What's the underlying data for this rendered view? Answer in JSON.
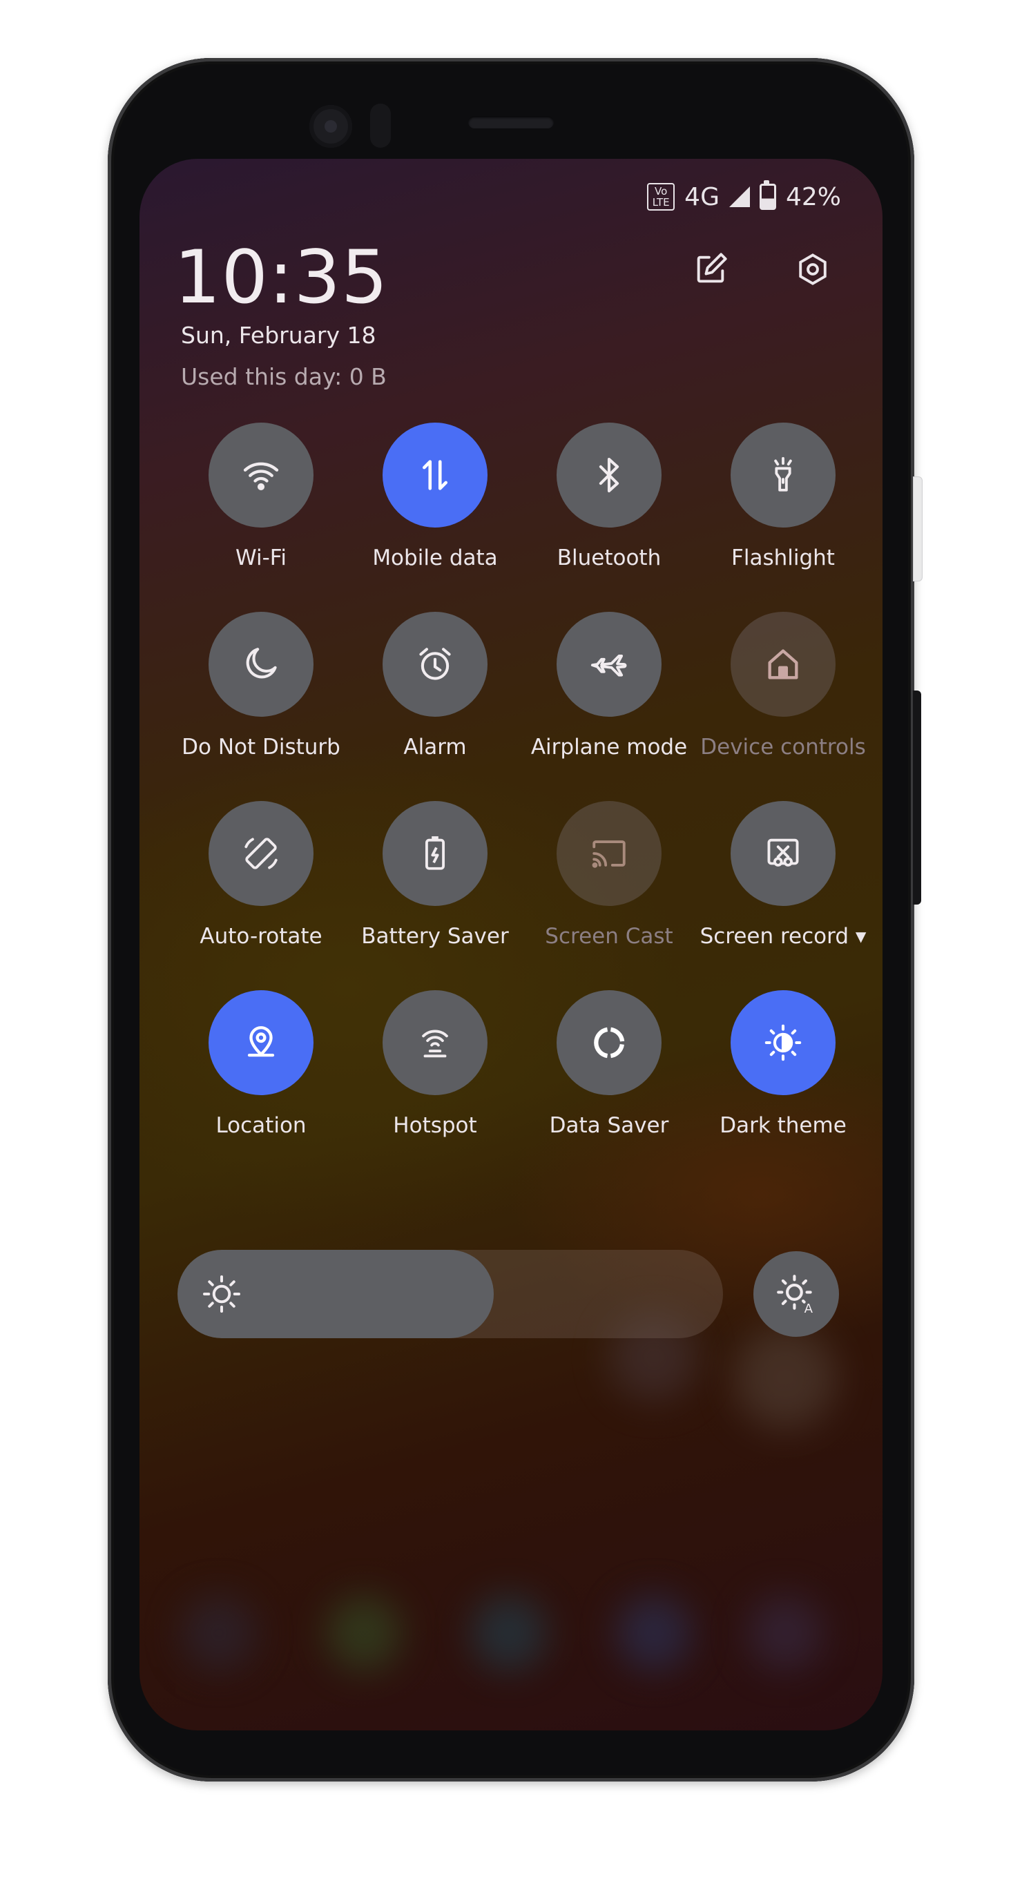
{
  "status_bar": {
    "volte": "Vo LTE",
    "network": "4G",
    "battery": "42%"
  },
  "header": {
    "time": "10:35",
    "date": "Sun, February 18",
    "usage": "Used this day: 0 B"
  },
  "tiles": [
    {
      "label": "Wi-Fi",
      "icon": "wifi-icon",
      "state": "off"
    },
    {
      "label": "Mobile data",
      "icon": "mobile-data-icon",
      "state": "on"
    },
    {
      "label": "Bluetooth",
      "icon": "bluetooth-icon",
      "state": "off"
    },
    {
      "label": "Flashlight",
      "icon": "flashlight-icon",
      "state": "off"
    },
    {
      "label": "Do Not Disturb",
      "icon": "moon-icon",
      "state": "off"
    },
    {
      "label": "Alarm",
      "icon": "alarm-icon",
      "state": "off"
    },
    {
      "label": "Airplane mode",
      "icon": "airplane-icon",
      "state": "off"
    },
    {
      "label": "Device controls",
      "icon": "home-icon",
      "state": "unavailable"
    },
    {
      "label": "Auto-rotate",
      "icon": "rotate-icon",
      "state": "off"
    },
    {
      "label": "Battery Saver",
      "icon": "battery-saver-icon",
      "state": "off"
    },
    {
      "label": "Screen Cast",
      "icon": "cast-icon",
      "state": "unavailable"
    },
    {
      "label": "Screen record ▾",
      "icon": "screen-record-icon",
      "state": "off"
    },
    {
      "label": "Location",
      "icon": "location-icon",
      "state": "on"
    },
    {
      "label": "Hotspot",
      "icon": "hotspot-icon",
      "state": "off"
    },
    {
      "label": "Data Saver",
      "icon": "data-saver-icon",
      "state": "off"
    },
    {
      "label": "Dark theme",
      "icon": "dark-theme-icon",
      "state": "on"
    }
  ],
  "brightness": {
    "level": 0.58,
    "icon": "brightness-icon",
    "auto_icon": "auto-brightness-icon"
  },
  "colors": {
    "tile_on": "#4a6ef5",
    "tile_off": "#5d5e62",
    "text": "#ece6ea"
  }
}
